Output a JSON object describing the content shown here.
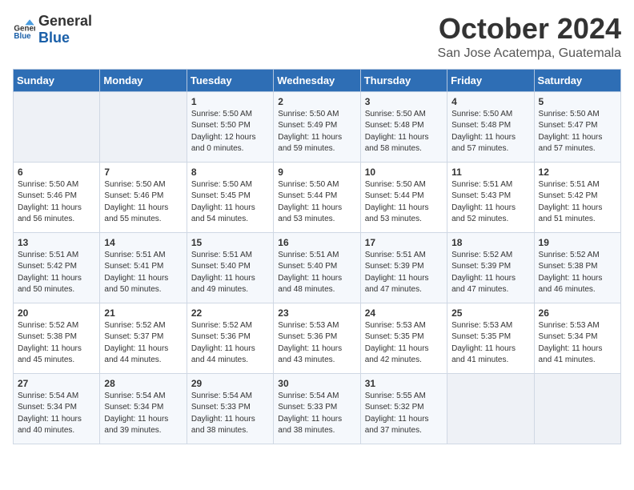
{
  "logo": {
    "text_general": "General",
    "text_blue": "Blue"
  },
  "title": "October 2024",
  "location": "San Jose Acatempa, Guatemala",
  "days_header": [
    "Sunday",
    "Monday",
    "Tuesday",
    "Wednesday",
    "Thursday",
    "Friday",
    "Saturday"
  ],
  "weeks": [
    [
      {
        "day": "",
        "info": ""
      },
      {
        "day": "",
        "info": ""
      },
      {
        "day": "1",
        "info": "Sunrise: 5:50 AM\nSunset: 5:50 PM\nDaylight: 12 hours\nand 0 minutes."
      },
      {
        "day": "2",
        "info": "Sunrise: 5:50 AM\nSunset: 5:49 PM\nDaylight: 11 hours\nand 59 minutes."
      },
      {
        "day": "3",
        "info": "Sunrise: 5:50 AM\nSunset: 5:48 PM\nDaylight: 11 hours\nand 58 minutes."
      },
      {
        "day": "4",
        "info": "Sunrise: 5:50 AM\nSunset: 5:48 PM\nDaylight: 11 hours\nand 57 minutes."
      },
      {
        "day": "5",
        "info": "Sunrise: 5:50 AM\nSunset: 5:47 PM\nDaylight: 11 hours\nand 57 minutes."
      }
    ],
    [
      {
        "day": "6",
        "info": "Sunrise: 5:50 AM\nSunset: 5:46 PM\nDaylight: 11 hours\nand 56 minutes."
      },
      {
        "day": "7",
        "info": "Sunrise: 5:50 AM\nSunset: 5:46 PM\nDaylight: 11 hours\nand 55 minutes."
      },
      {
        "day": "8",
        "info": "Sunrise: 5:50 AM\nSunset: 5:45 PM\nDaylight: 11 hours\nand 54 minutes."
      },
      {
        "day": "9",
        "info": "Sunrise: 5:50 AM\nSunset: 5:44 PM\nDaylight: 11 hours\nand 53 minutes."
      },
      {
        "day": "10",
        "info": "Sunrise: 5:50 AM\nSunset: 5:44 PM\nDaylight: 11 hours\nand 53 minutes."
      },
      {
        "day": "11",
        "info": "Sunrise: 5:51 AM\nSunset: 5:43 PM\nDaylight: 11 hours\nand 52 minutes."
      },
      {
        "day": "12",
        "info": "Sunrise: 5:51 AM\nSunset: 5:42 PM\nDaylight: 11 hours\nand 51 minutes."
      }
    ],
    [
      {
        "day": "13",
        "info": "Sunrise: 5:51 AM\nSunset: 5:42 PM\nDaylight: 11 hours\nand 50 minutes."
      },
      {
        "day": "14",
        "info": "Sunrise: 5:51 AM\nSunset: 5:41 PM\nDaylight: 11 hours\nand 50 minutes."
      },
      {
        "day": "15",
        "info": "Sunrise: 5:51 AM\nSunset: 5:40 PM\nDaylight: 11 hours\nand 49 minutes."
      },
      {
        "day": "16",
        "info": "Sunrise: 5:51 AM\nSunset: 5:40 PM\nDaylight: 11 hours\nand 48 minutes."
      },
      {
        "day": "17",
        "info": "Sunrise: 5:51 AM\nSunset: 5:39 PM\nDaylight: 11 hours\nand 47 minutes."
      },
      {
        "day": "18",
        "info": "Sunrise: 5:52 AM\nSunset: 5:39 PM\nDaylight: 11 hours\nand 47 minutes."
      },
      {
        "day": "19",
        "info": "Sunrise: 5:52 AM\nSunset: 5:38 PM\nDaylight: 11 hours\nand 46 minutes."
      }
    ],
    [
      {
        "day": "20",
        "info": "Sunrise: 5:52 AM\nSunset: 5:38 PM\nDaylight: 11 hours\nand 45 minutes."
      },
      {
        "day": "21",
        "info": "Sunrise: 5:52 AM\nSunset: 5:37 PM\nDaylight: 11 hours\nand 44 minutes."
      },
      {
        "day": "22",
        "info": "Sunrise: 5:52 AM\nSunset: 5:36 PM\nDaylight: 11 hours\nand 44 minutes."
      },
      {
        "day": "23",
        "info": "Sunrise: 5:53 AM\nSunset: 5:36 PM\nDaylight: 11 hours\nand 43 minutes."
      },
      {
        "day": "24",
        "info": "Sunrise: 5:53 AM\nSunset: 5:35 PM\nDaylight: 11 hours\nand 42 minutes."
      },
      {
        "day": "25",
        "info": "Sunrise: 5:53 AM\nSunset: 5:35 PM\nDaylight: 11 hours\nand 41 minutes."
      },
      {
        "day": "26",
        "info": "Sunrise: 5:53 AM\nSunset: 5:34 PM\nDaylight: 11 hours\nand 41 minutes."
      }
    ],
    [
      {
        "day": "27",
        "info": "Sunrise: 5:54 AM\nSunset: 5:34 PM\nDaylight: 11 hours\nand 40 minutes."
      },
      {
        "day": "28",
        "info": "Sunrise: 5:54 AM\nSunset: 5:34 PM\nDaylight: 11 hours\nand 39 minutes."
      },
      {
        "day": "29",
        "info": "Sunrise: 5:54 AM\nSunset: 5:33 PM\nDaylight: 11 hours\nand 38 minutes."
      },
      {
        "day": "30",
        "info": "Sunrise: 5:54 AM\nSunset: 5:33 PM\nDaylight: 11 hours\nand 38 minutes."
      },
      {
        "day": "31",
        "info": "Sunrise: 5:55 AM\nSunset: 5:32 PM\nDaylight: 11 hours\nand 37 minutes."
      },
      {
        "day": "",
        "info": ""
      },
      {
        "day": "",
        "info": ""
      }
    ]
  ]
}
